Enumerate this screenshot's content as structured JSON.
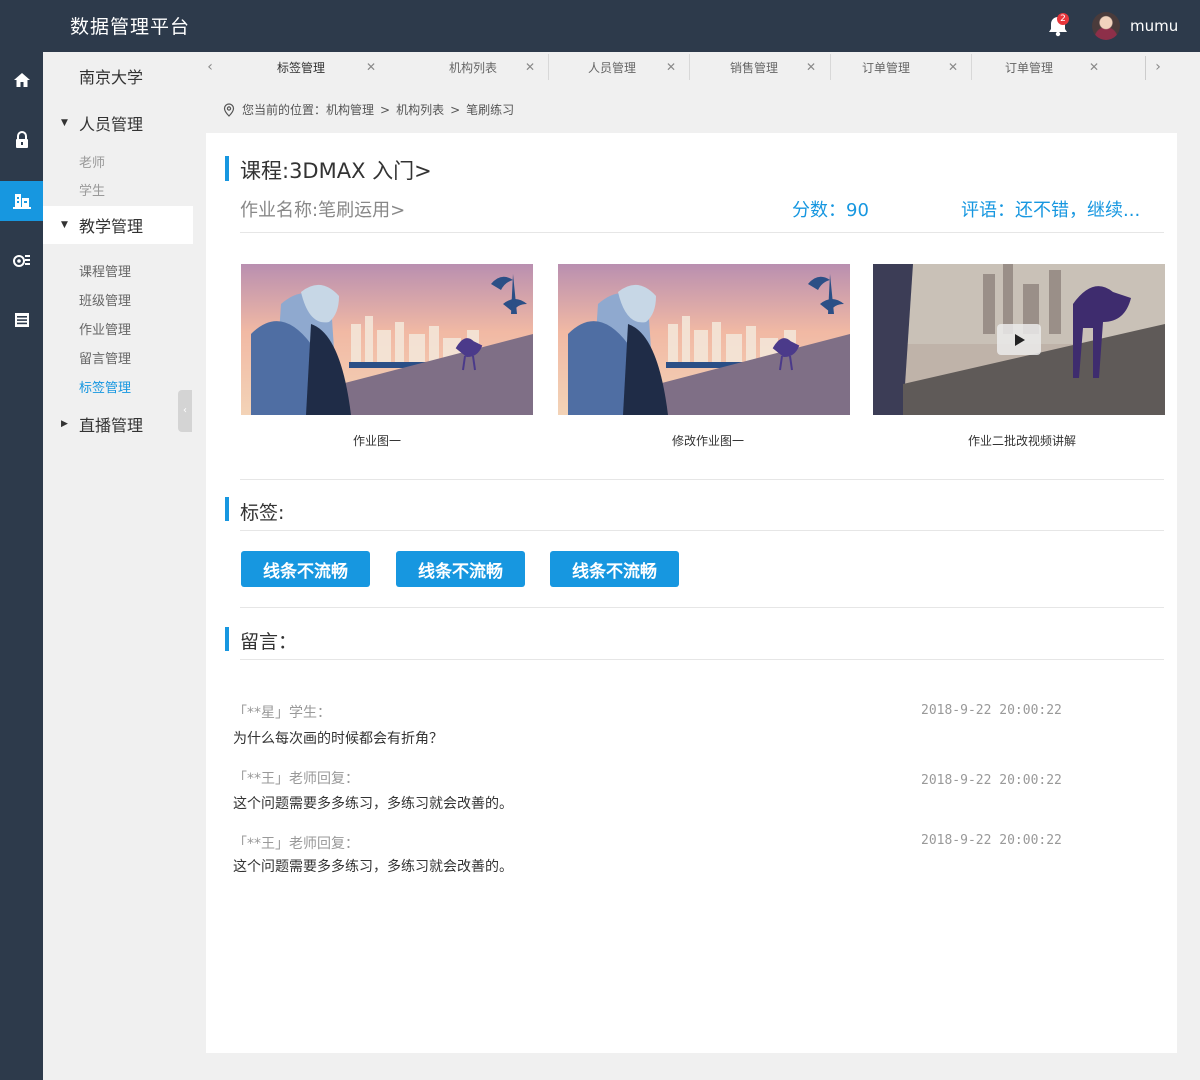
{
  "header": {
    "app_title": "数据管理平台",
    "notification_count": "2",
    "username": "mumu"
  },
  "rail": {
    "icons": [
      "home-icon",
      "lock-icon",
      "building-icon",
      "analytics-icon",
      "list-icon"
    ],
    "active_index": 2,
    "active_color": "#1797e0"
  },
  "sidebar": {
    "org_name": "南京大学",
    "groups": [
      {
        "label": "人员管理",
        "caret": "▼",
        "items": [
          "老师",
          "学生"
        ]
      },
      {
        "label": "教学管理",
        "caret": "▼",
        "items": [
          "课程管理",
          "班级管理",
          "作业管理",
          "留言管理",
          "标签管理"
        ]
      },
      {
        "label": "直播管理",
        "caret": "▶",
        "items": []
      }
    ],
    "active_item": "标签管理"
  },
  "tabs": [
    {
      "label": "标签管理",
      "active": true
    },
    {
      "label": "机构列表",
      "active": false
    },
    {
      "label": "人员管理",
      "active": false
    },
    {
      "label": "销售管理",
      "active": false
    },
    {
      "label": "订单管理",
      "active": false
    },
    {
      "label": "订单管理",
      "active": false
    }
  ],
  "breadcrumb": {
    "prefix": "您当前的位置：",
    "path": [
      "机构管理",
      "机构列表",
      "笔刷练习"
    ],
    "separator": ">"
  },
  "course": {
    "title": "课程:3DMAX 入门>",
    "homework_name": "作业名称:笔刷运用>",
    "score": "分数：90",
    "comment": "评语：还不错，继续..."
  },
  "gallery": [
    {
      "caption": "作业图一",
      "type": "image"
    },
    {
      "caption": "修改作业图一",
      "type": "image"
    },
    {
      "caption": "作业二批改视频讲解",
      "type": "video"
    }
  ],
  "tags": {
    "title": "标签:",
    "items": [
      "线条不流畅",
      "线条不流畅",
      "线条不流畅"
    ]
  },
  "messages": {
    "title": "留言：",
    "items": [
      {
        "author": "「**星」学生：",
        "time": "2018-9-22 20:00:22",
        "text": "为什么每次画的时候都会有折角？"
      },
      {
        "author": "「**王」老师回复：",
        "time": "2018-9-22 20:00:22",
        "text": "这个问题需要多多练习，多练习就会改善的。"
      },
      {
        "author": "「**王」老师回复：",
        "time": "2018-9-22 20:00:22",
        "text": "这个问题需要多多练习，多练习就会改善的。"
      }
    ]
  },
  "colors": {
    "header_bg": "#2d3a4b",
    "accent": "#1797e0",
    "page_bg": "#f0f0f0"
  }
}
